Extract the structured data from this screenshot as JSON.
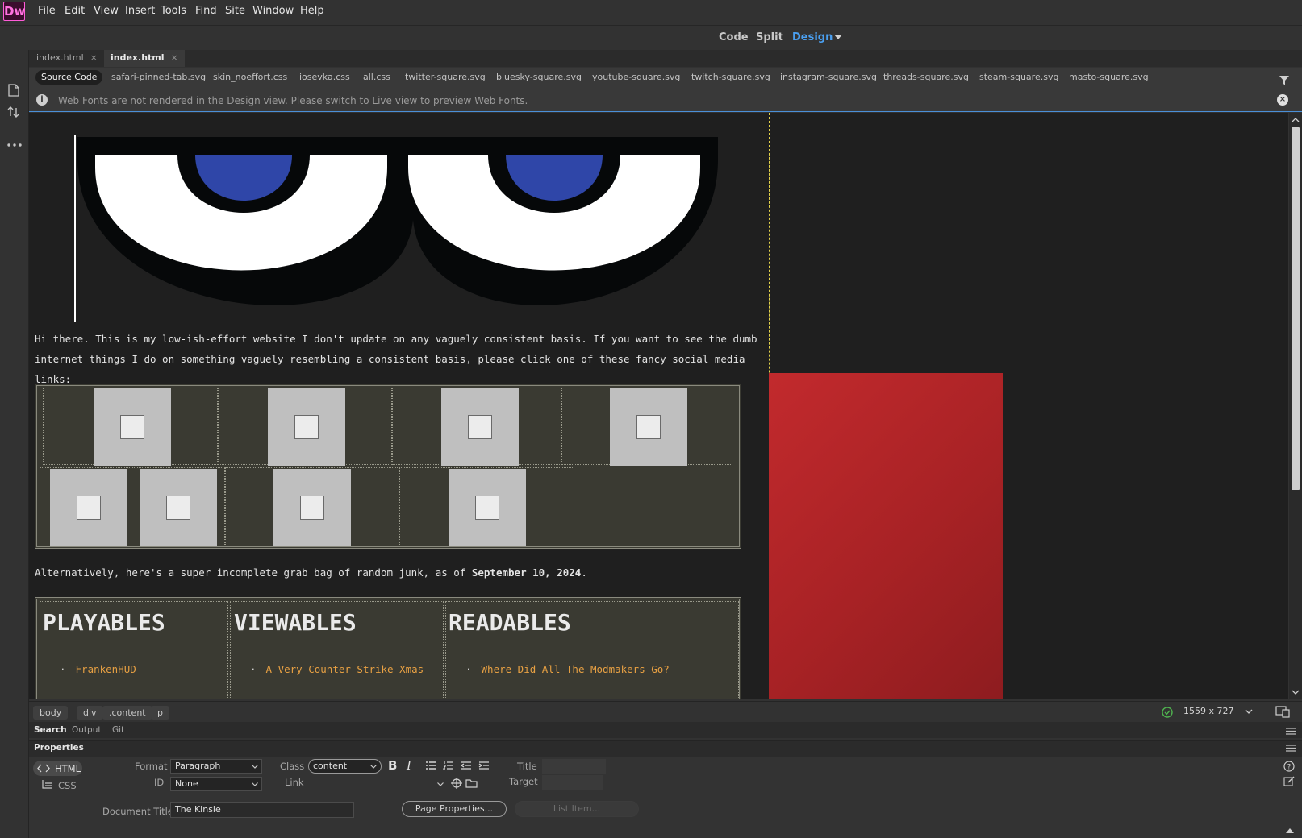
{
  "app": {
    "logo": "Dw"
  },
  "menu": [
    "File",
    "Edit",
    "View",
    "Insert",
    "Tools",
    "Find",
    "Site",
    "Window",
    "Help"
  ],
  "view_modes": {
    "code": "Code",
    "split": "Split",
    "design": "Design"
  },
  "doc_tabs": [
    {
      "label": "index.html",
      "active": false
    },
    {
      "label": "index.html",
      "active": true
    }
  ],
  "related_files": {
    "source": "Source Code",
    "files": [
      "safari-pinned-tab.svg",
      "skin_noeffort.css",
      "iosevka.css",
      "all.css",
      "twitter-square.svg",
      "bluesky-square.svg",
      "youtube-square.svg",
      "twitch-square.svg",
      "instagram-square.svg",
      "threads-square.svg",
      "steam-square.svg",
      "masto-square.svg"
    ]
  },
  "info_bar": {
    "message": "Web Fonts are not rendered in the Design view. Please switch to Live view to preview Web Fonts."
  },
  "page": {
    "intro": "Hi there. This is my low-ish-effort website I don't update on any vaguely consistent basis. If you want to see the dumb internet things I do on something vaguely resembling a consistent basis, please click one of these fancy social media links:",
    "alt_prefix": "Alternatively, here's a super incomplete grab bag of random junk, as of ",
    "alt_date": "September 10, 2024",
    "alt_suffix": ".",
    "sections": [
      {
        "heading": "PLAYABLES",
        "first_item": "FrankenHUD"
      },
      {
        "heading": "VIEWABLES",
        "first_item": "A Very Counter-Strike Xmas"
      },
      {
        "heading": "READABLES",
        "first_item": "Where Did All The Modmakers Go?"
      }
    ],
    "colors": {
      "eye_iris": "#2f46a8",
      "link": "#e7a043",
      "red_panel": "#b3262a"
    }
  },
  "tag_selector": [
    "body",
    "div",
    ".content",
    "p"
  ],
  "window_size": "1559 x 727",
  "panel_tabs": [
    "Search",
    "Output",
    "Git"
  ],
  "properties": {
    "title": "Properties",
    "html_label": "HTML",
    "css_label": "CSS",
    "format_label": "Format",
    "format_value": "Paragraph",
    "id_label": "ID",
    "id_value": "None",
    "class_label": "Class",
    "class_value": "content",
    "link_label": "Link",
    "title_label": "Title",
    "target_label": "Target",
    "doc_title_label": "Document Title",
    "doc_title_value": "The Kinsie",
    "page_props_button": "Page Properties...",
    "list_item_button": "List Item..."
  }
}
